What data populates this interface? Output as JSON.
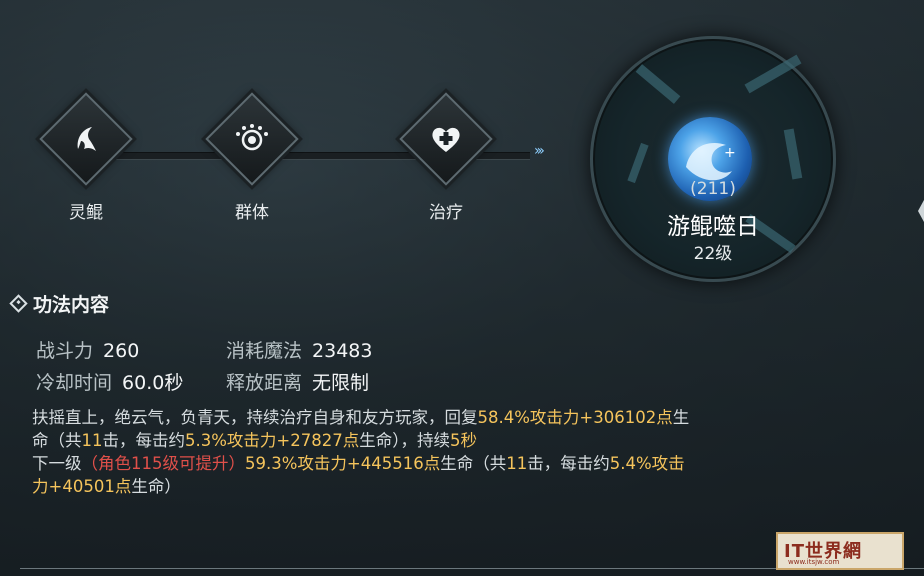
{
  "chain": {
    "nodes": [
      {
        "label": "灵鲲",
        "icon": "dolphin-icon"
      },
      {
        "label": "群体",
        "icon": "group-icon"
      },
      {
        "label": "治疗",
        "icon": "heart-plus-icon"
      }
    ],
    "arrows": "›››"
  },
  "skill": {
    "count": "(211)",
    "name": "游鲲噬日",
    "level": "22级",
    "icon": "skill-orb-icon"
  },
  "section": {
    "title": "功法内容"
  },
  "stats": {
    "power_label": "战斗力",
    "power_value": "260",
    "mana_label": "消耗魔法",
    "mana_value": "23483",
    "cooldown_label": "冷却时间",
    "cooldown_value": "60.0秒",
    "range_label": "释放距离",
    "range_value": "无限制"
  },
  "desc": {
    "p1": "扶摇直上，绝云气，负青天，持续治疗自身和友方玩家，回复",
    "p1_gold": "58.4%攻击力+306102点",
    "p1_end": "生",
    "p2": "命（共",
    "p2_gold1": "11",
    "p2_b": "击，每击约",
    "p2_gold2": "5.3%攻击力+27827点",
    "p2_c": "生命），持续",
    "p2_gold3": "5秒",
    "p3": "下一级",
    "p3_red": "（角色115级可提升）",
    "p3_gold": "59.3%攻击力+445516点",
    "p3_b": "生命（共",
    "p3_gold2": "11",
    "p3_c": "击，每击约",
    "p3_gold3": "5.4%攻击",
    "p4_gold": "力+40501点",
    "p4": "生命）"
  },
  "watermark": {
    "logo": "IT世界網",
    "sub": "www.itsjw.com"
  },
  "colors": {
    "gold": "#f5c45c",
    "red": "#e0504a"
  }
}
